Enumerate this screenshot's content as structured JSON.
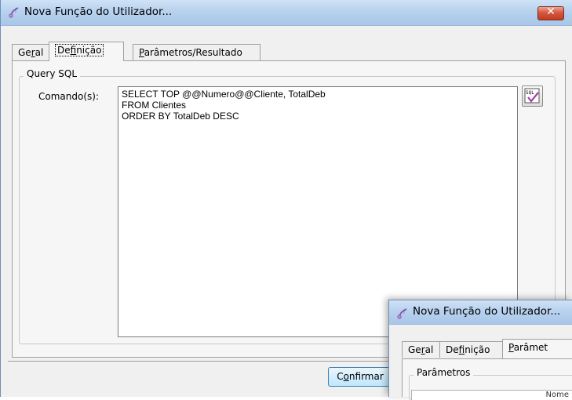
{
  "main_window": {
    "title": "Nova Função do Utilizador...",
    "close_label": "✕",
    "tabs": [
      {
        "pre": "Ge",
        "acc": "r",
        "post": "al"
      },
      {
        "pre": "De",
        "acc": "f",
        "post": "inição"
      },
      {
        "pre": "",
        "acc": "P",
        "post": "arâmetros/Resultado"
      }
    ],
    "group_title": "Query SQL",
    "command_label": "Comando(s):",
    "command_lines": [
      "SELECT TOP @@Numero@@Cliente, TotalDeb",
      "FROM Clientes",
      "ORDER BY TotalDeb DESC"
    ],
    "sql_button_label": "SQL",
    "confirm": {
      "pre": "C",
      "acc": "o",
      "post": "nfirmar"
    }
  },
  "second_window": {
    "title": "Nova Função do Utilizador...",
    "tabs": [
      {
        "pre": "Ge",
        "acc": "r",
        "post": "al"
      },
      {
        "pre": "De",
        "acc": "f",
        "post": "inição"
      },
      {
        "pre": "",
        "acc": "P",
        "post": "arâmet"
      }
    ],
    "group_title": "Parâmetros",
    "grid_header": "Nome"
  }
}
